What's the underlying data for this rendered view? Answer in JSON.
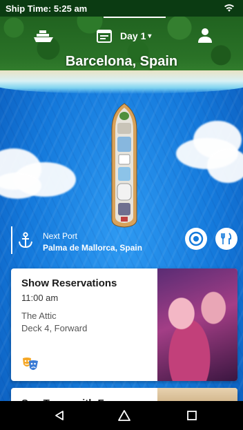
{
  "status_bar": {
    "ship_time": "Ship Time: 5:25 am",
    "wifi_icon": "wifi-icon"
  },
  "header": {
    "ship_icon": "ship-icon",
    "day_label": "Day 1",
    "profile_icon": "profile-icon",
    "port": "Barcelona, Spain"
  },
  "next_port": {
    "label": "Next Port",
    "value": "Palma de Mallorca, Spain"
  },
  "quick_actions": [
    {
      "icon": "eye-icon"
    },
    {
      "icon": "fork-knife-icon"
    }
  ],
  "cards": [
    {
      "title": "Show Reservations",
      "time": "11:00 am",
      "venue": "The Attic",
      "location": "Deck 4, Forward",
      "icon": "theater-masks-icon"
    },
    {
      "title": "Spa Tours with Free"
    }
  ],
  "nav": {
    "back": "back-icon",
    "home": "home-icon",
    "recents": "recents-icon"
  },
  "colors": {
    "ocean": "#1479db",
    "status_bar": "#0b3b12",
    "accent_masks": "#f5a623"
  }
}
